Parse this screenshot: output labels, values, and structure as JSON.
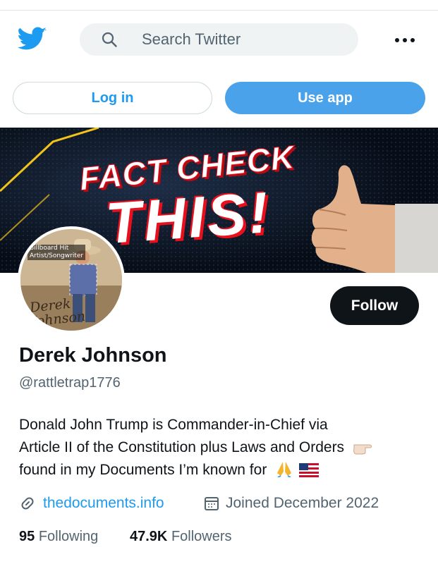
{
  "header": {
    "search_placeholder": "Search Twitter",
    "icons": [
      "twitter-bird-icon",
      "search-icon",
      "more-dots-icon"
    ]
  },
  "actions": {
    "login_label": "Log in",
    "use_app_label": "Use app",
    "follow_label": "Follow"
  },
  "banner": {
    "line1": "FACT CHECK",
    "line2": "THIS!"
  },
  "avatar": {
    "badge_line1": "Billboard Hit",
    "badge_line2": "Artist/Songwriter",
    "signature": "Derek Johnson"
  },
  "profile": {
    "name": "Derek Johnson",
    "handle": "@rattletrap1776",
    "bio_lines": [
      "Donald John Trump is Commander-in-Chief via",
      "Article II of the Constitution plus Laws and Orders",
      "found in my Documents I’m known for"
    ],
    "website": "thedocuments.info",
    "joined": "Joined December 2022",
    "following_count": "95",
    "following_label": "Following",
    "followers_count": "47.9K",
    "followers_label": "Followers"
  },
  "colors": {
    "accent": "#1d9bf0",
    "use_app_bg": "#4aa3ea",
    "follow_bg": "#0f1419",
    "muted_text": "#536471",
    "banner_text_red": "#e8101c"
  }
}
